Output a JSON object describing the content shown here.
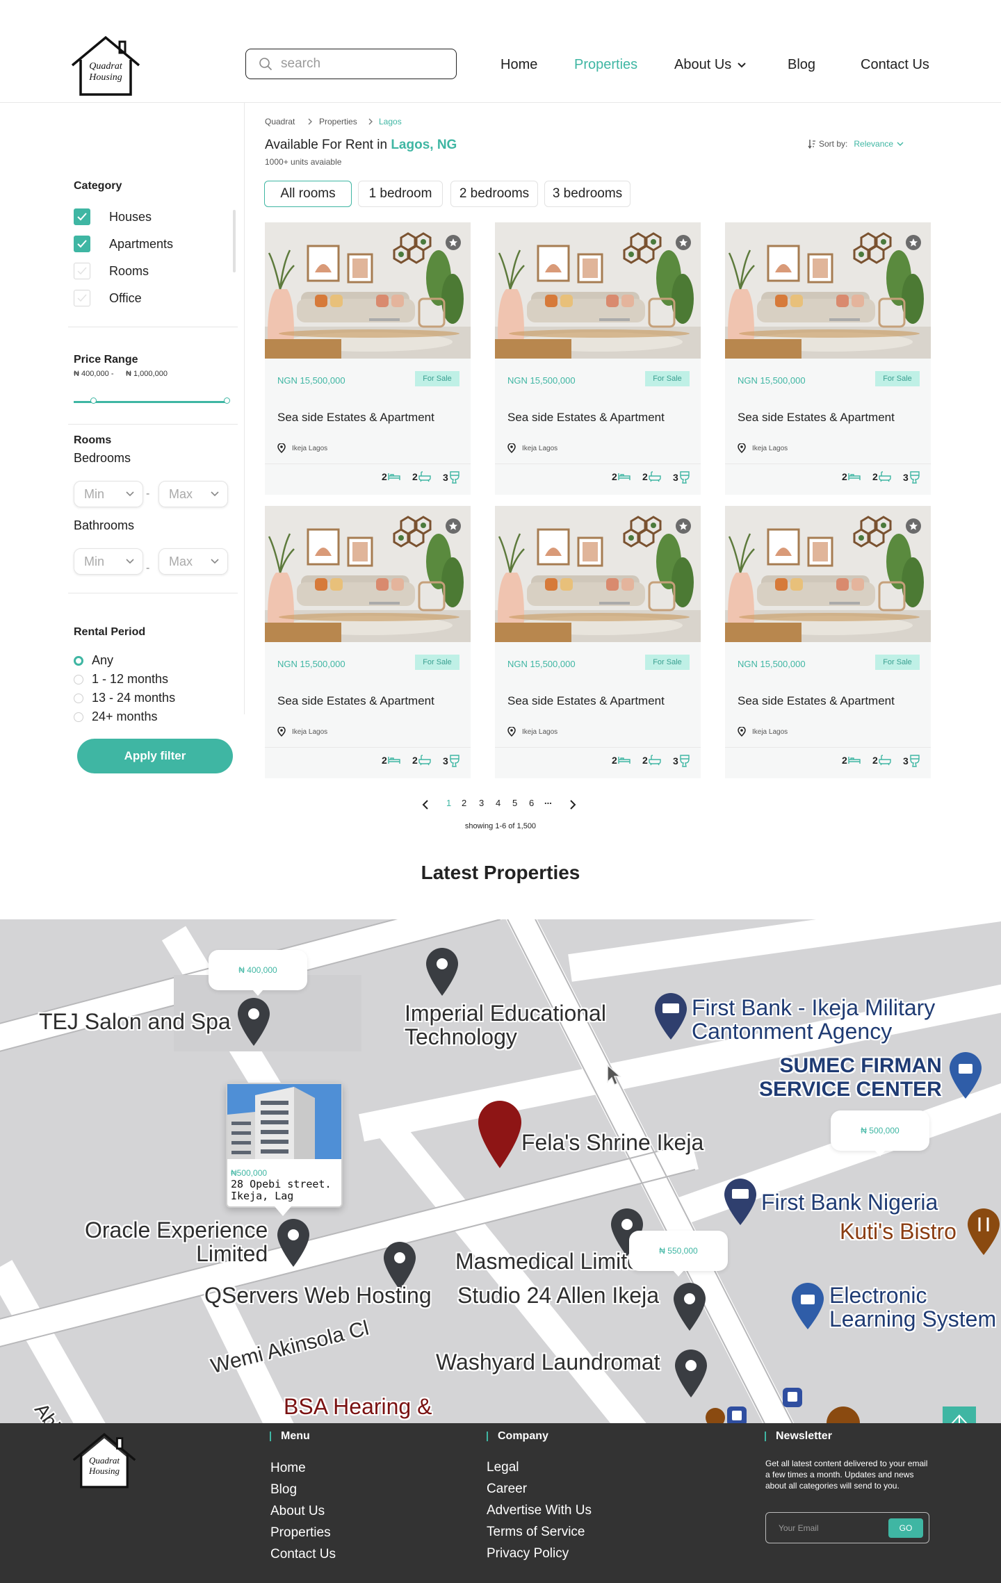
{
  "brand": {
    "logo_line1": "Quadrat",
    "logo_line2": "Housing"
  },
  "search": {
    "placeholder": "search"
  },
  "nav": {
    "items": [
      "Home",
      "Properties",
      "About Us",
      "Blog",
      "Contact Us"
    ],
    "active": "Properties"
  },
  "breadcrumb": [
    "Quadrat",
    "Properties",
    "Lagos"
  ],
  "listing": {
    "title_prefix": "Available For Rent in ",
    "title_location": "Lagos, NG",
    "units": "1000+ units avaiable",
    "sort_label": "Sort by:",
    "sort_value": "Relevance",
    "tabs": [
      "All rooms",
      "1 bedroom",
      "2 bedrooms",
      "3 bedrooms"
    ]
  },
  "filters": {
    "category_title": "Category",
    "categories": [
      {
        "label": "Houses",
        "checked": true
      },
      {
        "label": "Apartments",
        "checked": true
      },
      {
        "label": "Rooms",
        "checked": false
      },
      {
        "label": "Office",
        "checked": false
      }
    ],
    "price_title": "Price Range",
    "price_min": "₦ 400,000 -",
    "price_max": "₦ 1,000,000",
    "rooms_title": "Rooms",
    "bedrooms_label": "Bedrooms",
    "bathrooms_label": "Bathrooms",
    "min_label": "Min",
    "max_label": "Max",
    "dash": "-",
    "rental_title": "Rental Period",
    "rental_options": [
      "Any",
      "1 - 12 months",
      "13 - 24 months",
      "24+ months"
    ],
    "rental_selected": "Any",
    "apply_label": "Apply filter"
  },
  "cards": [
    {
      "price": "NGN 15,500,000",
      "badge": "For Sale",
      "title": "Sea side Estates & Apartment",
      "location": "Ikeja Lagos",
      "beds": "2",
      "baths": "2",
      "toilets": "3"
    },
    {
      "price": "NGN 15,500,000",
      "badge": "For Sale",
      "title": "Sea side Estates & Apartment",
      "location": "Ikeja Lagos",
      "beds": "2",
      "baths": "2",
      "toilets": "3"
    },
    {
      "price": "NGN 15,500,000",
      "badge": "For Sale",
      "title": "Sea side Estates & Apartment",
      "location": "Ikeja Lagos",
      "beds": "2",
      "baths": "2",
      "toilets": "3"
    },
    {
      "price": "NGN 15,500,000",
      "badge": "For Sale",
      "title": "Sea side Estates & Apartment",
      "location": "Ikeja Lagos",
      "beds": "2",
      "baths": "2",
      "toilets": "3"
    },
    {
      "price": "NGN 15,500,000",
      "badge": "For Sale",
      "title": "Sea side Estates & Apartment",
      "location": "Ikeja Lagos",
      "beds": "2",
      "baths": "2",
      "toilets": "3"
    },
    {
      "price": "NGN 15,500,000",
      "badge": "For Sale",
      "title": "Sea side Estates & Apartment",
      "location": "Ikeja Lagos",
      "beds": "2",
      "baths": "2",
      "toilets": "3"
    }
  ],
  "pagination": {
    "pages": [
      "1",
      "2",
      "3",
      "4",
      "5",
      "6",
      "..."
    ],
    "current": "1",
    "summary": "showing 1-6 of 1,500"
  },
  "latest": {
    "title": "Latest Properties"
  },
  "map": {
    "labels": {
      "tej": "TEJ Salon and Spa",
      "imperial": "Imperial Educational\nTechnology",
      "firstbank_military": "First Bank - Ikeja Military\nCantonment Agency",
      "sumec": "SUMEC FIRMAN\nSERVICE CENTER",
      "felas": "Fela's Shrine Ikeja",
      "firstbank_nigeria": "First Bank Nigeria",
      "kutis": "Kuti's Bistro",
      "oracle": "Oracle Experience\nLimited",
      "masmedical": "Masmedical Limited",
      "qservers": "QServers Web Hosting",
      "studio24": "Studio 24 Allen Ikeja",
      "electronic": "Electronic\nLearning System",
      "wemi": "Wemi Akinsola Cl",
      "washyard": "Washyard Laundromat",
      "bsa": "BSA Hearing &",
      "abio": "Abio"
    },
    "bubbles": [
      "₦ 400,000",
      "₦ 500,000",
      "₦ 550,000"
    ],
    "popup": {
      "price": "₦500,000",
      "address": "28 Opebi street. Ikeja, Lag"
    }
  },
  "footer": {
    "menu_title": "Menu",
    "menu": [
      "Home",
      "Blog",
      "About Us",
      "Properties",
      "Contact Us"
    ],
    "company_title": "Company",
    "company": [
      "Legal",
      "Career",
      "Advertise With Us",
      "Terms of Service",
      "Privacy Policy"
    ],
    "newsletter_title": "Newsletter",
    "newsletter_text": "Get all latest content delivered to your email a few times a month. Updates and news about all categories will send to you.",
    "email_placeholder": "Your Email",
    "go_label": "GO"
  },
  "colors": {
    "accent": "#3fb6a3",
    "footer_bg": "#333333",
    "map_bg": "#d4d4d6"
  }
}
